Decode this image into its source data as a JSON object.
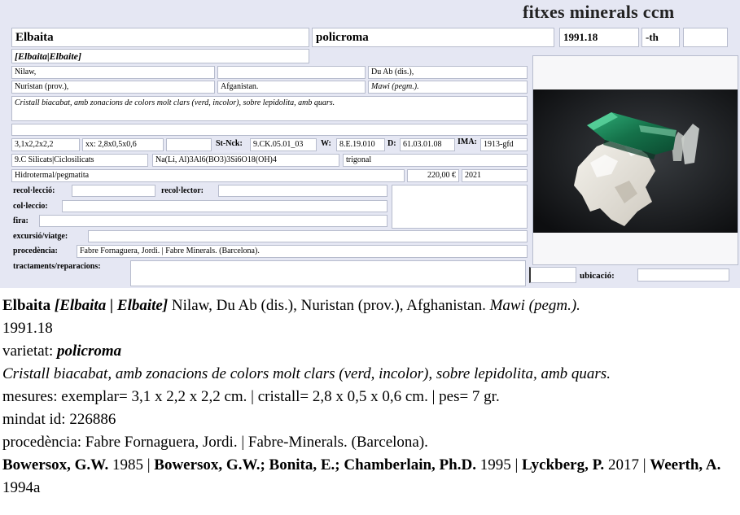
{
  "brand": "fitxes minerals ccm",
  "record": {
    "name": "Elbaita",
    "variety": "policroma",
    "code": "1991.18",
    "suffix": "-th",
    "extra": "",
    "synonyms": "[Elbaita|Elbaite]",
    "loc1": "Nilaw,",
    "loc2": "",
    "loc3": "Du Ab (dis.),",
    "province": "Nuristan (prov.),",
    "country": "Afganistan.",
    "deposit": "Mawi (pegm.).",
    "description": "Cristall biacabat, amb zonacions de colors molt clars (verd, incolor), sobre lepidolita, amb quars.",
    "blank_row": "",
    "size": "3,1x2,2x2,2",
    "crystal": "xx: 2,8x0,5x0,6",
    "blank_cell": "",
    "stnck_label": "St-Nck:",
    "stnck": "9.CK.05.01_03",
    "w_label": "W:",
    "w": "8.E.19.010",
    "d_label": "D:",
    "d": "61.03.01.08",
    "ima_label": "IMA:",
    "ima": "1913-gfd",
    "classification": "9.C Silicats|Ciclosilicats",
    "formula": "Na(Li, Al)3Al6(BO3)3Si6O18(OH)4",
    "system": "trigonal",
    "genesis": "Hidrotermal/pegmatita",
    "price": "220,00 €",
    "year": "2021",
    "recol_leccio_label": "recol·lecció:",
    "recol_leccio": "",
    "recol_lector_label": "recol·lector:",
    "recol_lector": "",
    "col_leccio_label": "col·leccio:",
    "col_leccio": "",
    "fira_label": "fira:",
    "fira": "",
    "excursio_label": "excursió/viatge:",
    "excursio": "",
    "procedencia_label": "procedència:",
    "procedencia": "Fabre Fornaguera, Jordi. | Fabre Minerals. (Barcelona).",
    "tractaments_label": "tractaments/reparacions:",
    "tractaments": "",
    "small_box": "",
    "ubicacio_label": "ubicació:",
    "ubicacio": "",
    "notes_box": ""
  },
  "summary": {
    "name": "Elbaita",
    "synonyms": "[Elbaita | Elbaite]",
    "locality": " Nilaw, Du Ab (dis.), Nuristan (prov.), Afghanistan. ",
    "deposit": "Mawi (pegm.).",
    "code": "1991.18",
    "variety_label": "varietat: ",
    "variety": "policroma",
    "description": "Cristall biacabat, amb zonacions de colors molt clars (verd, incolor), sobre lepidolita, amb quars.",
    "measures": "mesures: exemplar=  3,1 x 2,2 x 2,2 cm. | cristall=  2,8 x 0,5 x 0,6 cm. | pes= 7 gr.",
    "mindat": "mindat id: 226886",
    "procedencia": "procedència: Fabre Fornaguera, Jordi. | Fabre-Minerals. (Barcelona).",
    "refs": [
      {
        "author": "Bowersox, G.W.",
        "year": " 1985"
      },
      {
        "author": "Bowersox, G.W.; Bonita, E.; Chamberlain, Ph.D.",
        "year": " 1995"
      },
      {
        "author": "Lyckberg, P.",
        "year": " 2017"
      },
      {
        "author": "Weerth, A.",
        "year": " 1994a"
      }
    ],
    "sep": " | "
  },
  "colors": {
    "form_bg": "#e5e7f3",
    "field_border": "#b7bccd",
    "crystal_green": "#1e8a5a",
    "matrix_white": "#e8e6df"
  },
  "icons": {
    "specimen": "mineral-specimen-photo"
  }
}
